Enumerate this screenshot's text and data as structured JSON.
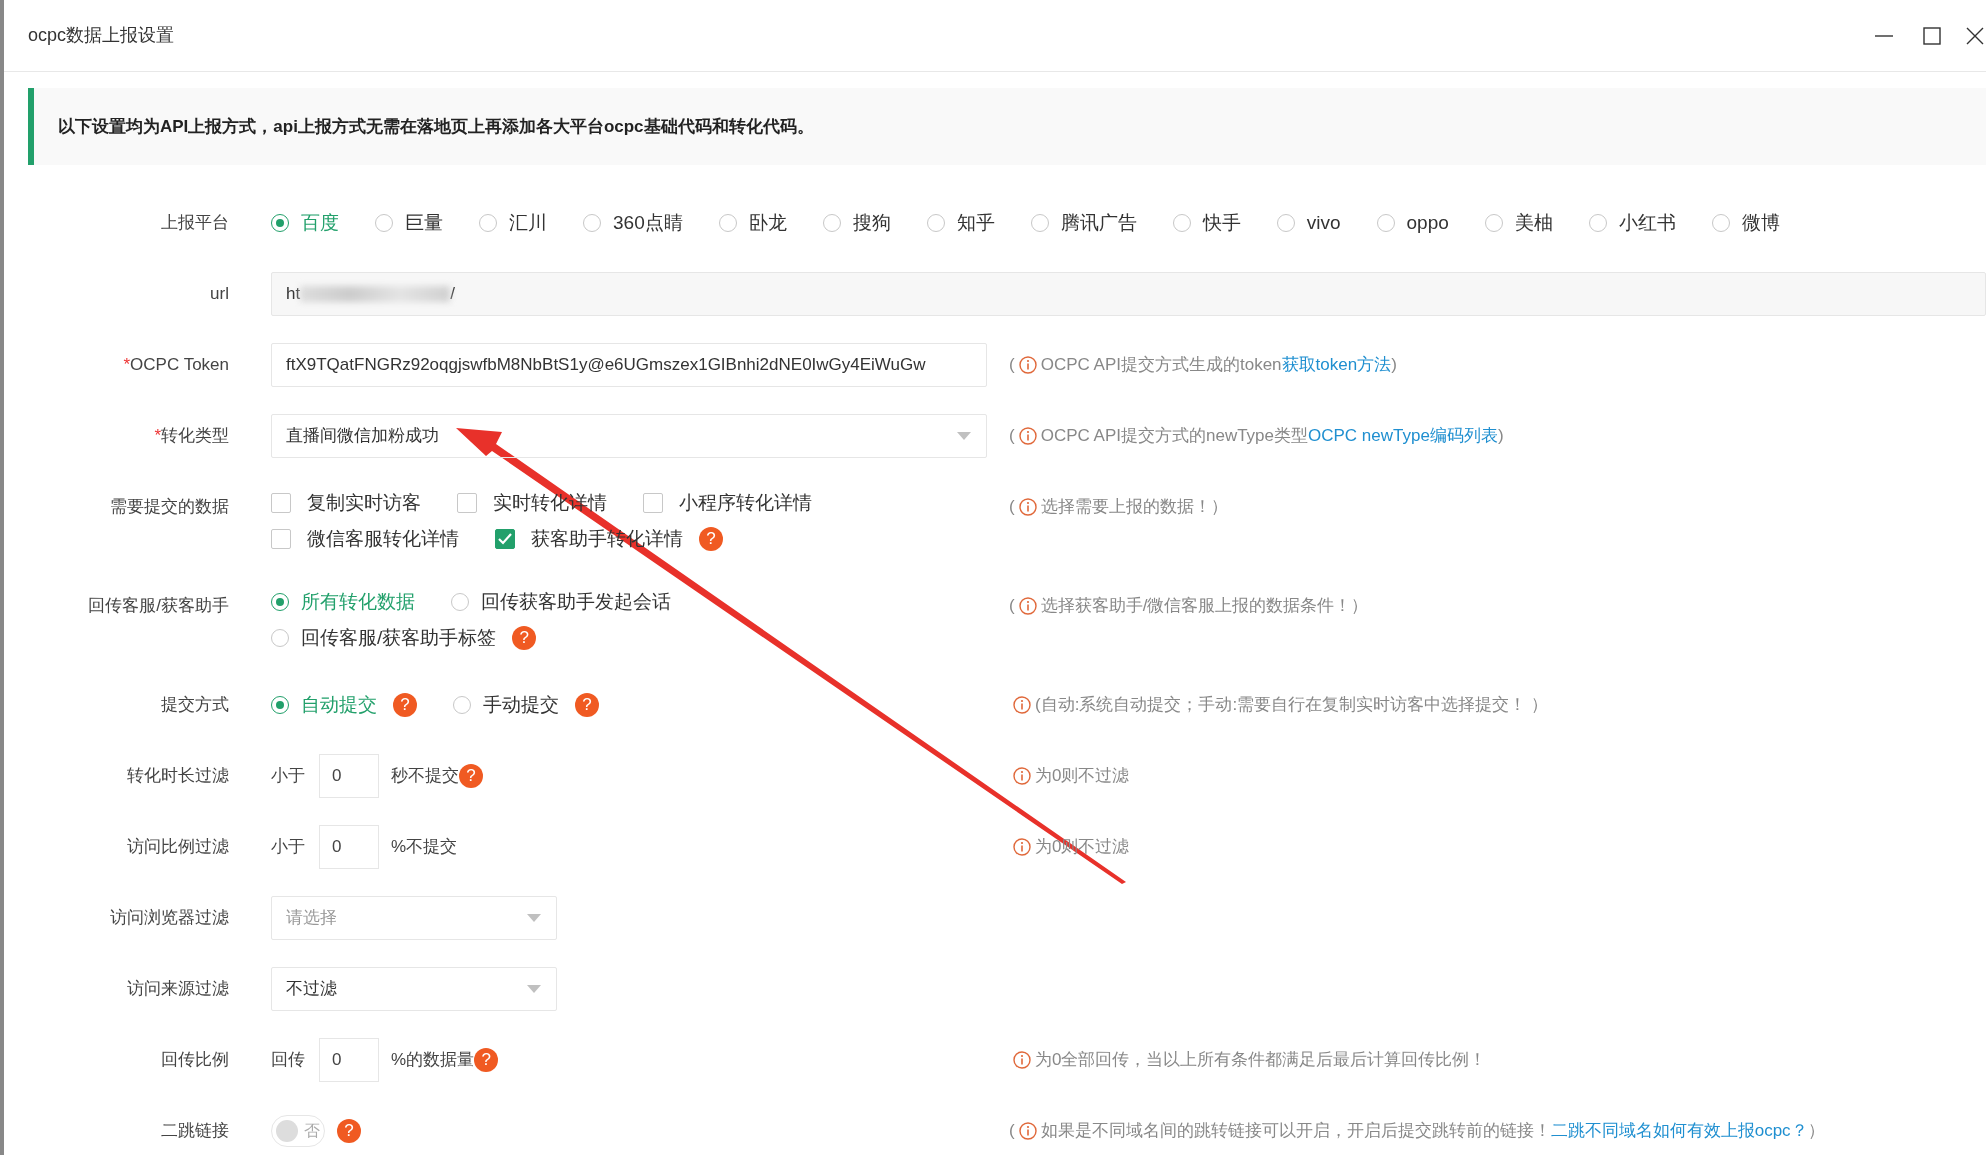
{
  "window": {
    "title": "ocpc数据上报设置"
  },
  "notice": "以下设置均为API上报方式，api上报方式无需在落地页上再添加各大平台ocpc基础代码和转化代码。",
  "rows": [
    {
      "kind": "radio_group",
      "label": "上报平台",
      "lines": [
        [
          {
            "label": "百度",
            "selected": true
          },
          {
            "label": "巨量",
            "selected": false
          },
          {
            "label": "汇川",
            "selected": false
          },
          {
            "label": "360点睛",
            "selected": false
          },
          {
            "label": "卧龙",
            "selected": false
          },
          {
            "label": "搜狗",
            "selected": false
          },
          {
            "label": "知乎",
            "selected": false
          },
          {
            "label": "腾讯广告",
            "selected": false
          },
          {
            "label": "快手",
            "selected": false
          },
          {
            "label": "vivo",
            "selected": false
          },
          {
            "label": "oppo",
            "selected": false
          },
          {
            "label": "美柚",
            "selected": false
          },
          {
            "label": "小红书",
            "selected": false
          },
          {
            "label": "微博",
            "selected": false
          }
        ]
      ]
    },
    {
      "kind": "readonly",
      "label": "url",
      "value_start": "ht",
      "value_end": "/"
    },
    {
      "kind": "input",
      "label": "OCPC Token",
      "required_mark": "*",
      "value": "ftX9TQatFNGRz92oqgjswfbM8NbBtS1y@e6UGmszex1GIBnhi2dNE0IwGy4EiWuGw",
      "hint": {
        "open": "(",
        "text": "OCPC API提交方式生成的token ",
        "link": "获取token方法",
        "close": ")"
      }
    },
    {
      "kind": "select",
      "label": "转化类型",
      "required_mark": "*",
      "value": "直播间微信加粉成功",
      "hint": {
        "open": "(",
        "text": "OCPC API提交方式的newType类型 ",
        "link": "OCPC newType编码列表",
        "close": ")"
      }
    },
    {
      "kind": "checkbox_group",
      "label": "需要提交的数据",
      "lines": [
        [
          {
            "label": "复制实时访客",
            "checked": false
          },
          {
            "label": "实时转化详情",
            "checked": false
          },
          {
            "label": "小程序转化详情",
            "checked": false
          }
        ],
        [
          {
            "label": "微信客服转化详情",
            "checked": false
          },
          {
            "label": "获客助手转化详情",
            "checked": true,
            "help": "?"
          }
        ]
      ],
      "hint": {
        "open": "(",
        "text": "选择需要上报的数据！）"
      }
    },
    {
      "kind": "radio_group",
      "label": "回传客服/获客助手",
      "lines": [
        [
          {
            "label": "所有转化数据",
            "selected": true
          },
          {
            "label": "回传获客助手发起会话",
            "selected": false
          }
        ],
        [
          {
            "label": "回传客服/获客助手标签",
            "selected": false,
            "help": "?"
          }
        ]
      ],
      "hint": {
        "open": "(",
        "text": "选择获客助手/微信客服上报的数据条件！）"
      }
    },
    {
      "kind": "radio_group",
      "label": "提交方式",
      "lines": [
        [
          {
            "label": "自动提交",
            "selected": true,
            "help": "?"
          },
          {
            "label": "手动提交",
            "selected": false,
            "help": "?"
          }
        ]
      ],
      "hint": {
        "text": "(自动:系统自动提交；手动:需要自行在复制实时访客中选择提交！ ）"
      }
    },
    {
      "kind": "number",
      "label": "转化时长过滤",
      "prefix": "小于",
      "value": "0",
      "suffix": "秒不提交",
      "help": "?",
      "hint": {
        "text": "为0则不过滤"
      }
    },
    {
      "kind": "number",
      "label": "访问比例过滤",
      "prefix": "小于",
      "value": "0",
      "suffix": "%不提交",
      "hint": {
        "text": "为0则不过滤"
      }
    },
    {
      "kind": "filter_select",
      "label": "访问浏览器过滤",
      "placeholder": "请选择"
    },
    {
      "kind": "filter_select",
      "label": "访问来源过滤",
      "value": "不过滤"
    },
    {
      "kind": "number",
      "label": "回传比例",
      "prefix": "回传",
      "value": "0",
      "suffix": "%的数据量",
      "help": "?",
      "hint": {
        "text": "为0全部回传，当以上所有条件都满足后最后计算回传比例！"
      }
    },
    {
      "kind": "switch",
      "label": "二跳链接",
      "on": false,
      "text": "否",
      "help": "?",
      "hint": {
        "open": "(",
        "text": "如果是不同域名间的跳转链接可以开启，开启后提交跳转前的链接！ ",
        "link": "二跳不同域名如何有效上报ocpc？",
        "close": "）"
      }
    }
  ]
}
